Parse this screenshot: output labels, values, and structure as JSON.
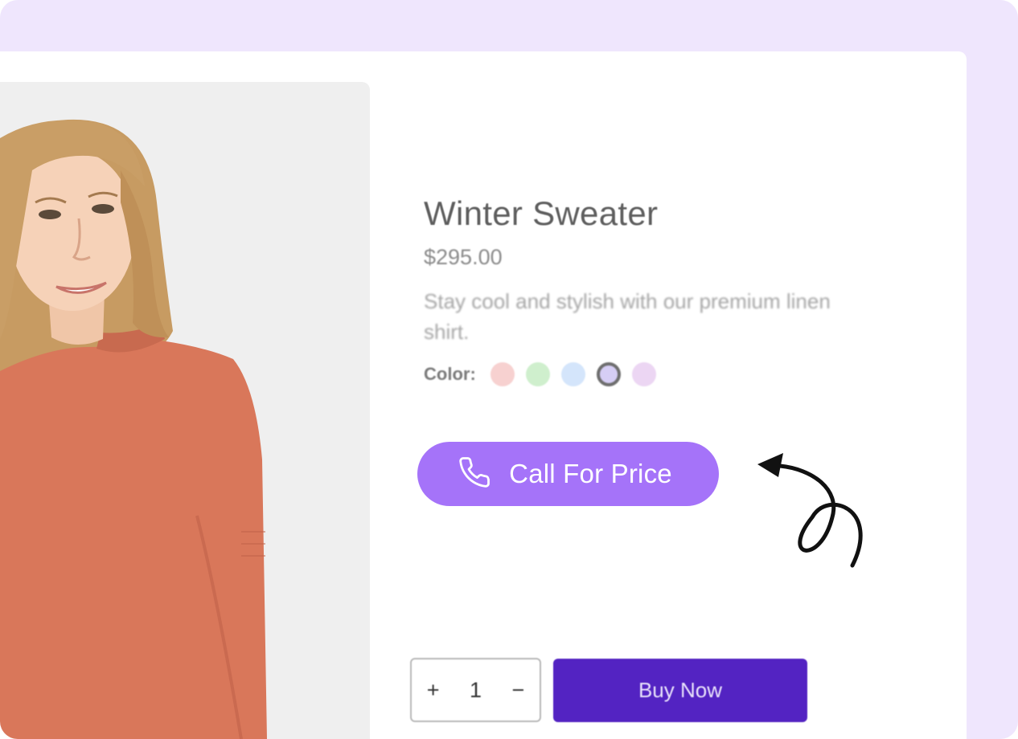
{
  "product": {
    "title": "Winter Sweater",
    "price": "$295.00",
    "description": "Stay cool and stylish with our premium linen shirt.",
    "color_label": "Color:",
    "colors": [
      {
        "name": "pink",
        "hex": "#f7d1d0",
        "selected": false
      },
      {
        "name": "green",
        "hex": "#cfefcd",
        "selected": false
      },
      {
        "name": "blue",
        "hex": "#d4e5fb",
        "selected": false
      },
      {
        "name": "lavender",
        "hex": "#d6cef5",
        "selected": true
      },
      {
        "name": "light-purple",
        "hex": "#ecd6f3",
        "selected": false
      }
    ]
  },
  "cta": {
    "label": "Call For Price",
    "icon": "phone-icon",
    "bg": "#a573f9"
  },
  "purchase": {
    "plus": "+",
    "quantity": "1",
    "minus": "−",
    "buy_label": "Buy Now",
    "buy_bg": "#5323c2"
  },
  "theme": {
    "frame_bg": "#efe6fd",
    "image_bg": "#efefef",
    "sweater_color": "#d9775a"
  }
}
